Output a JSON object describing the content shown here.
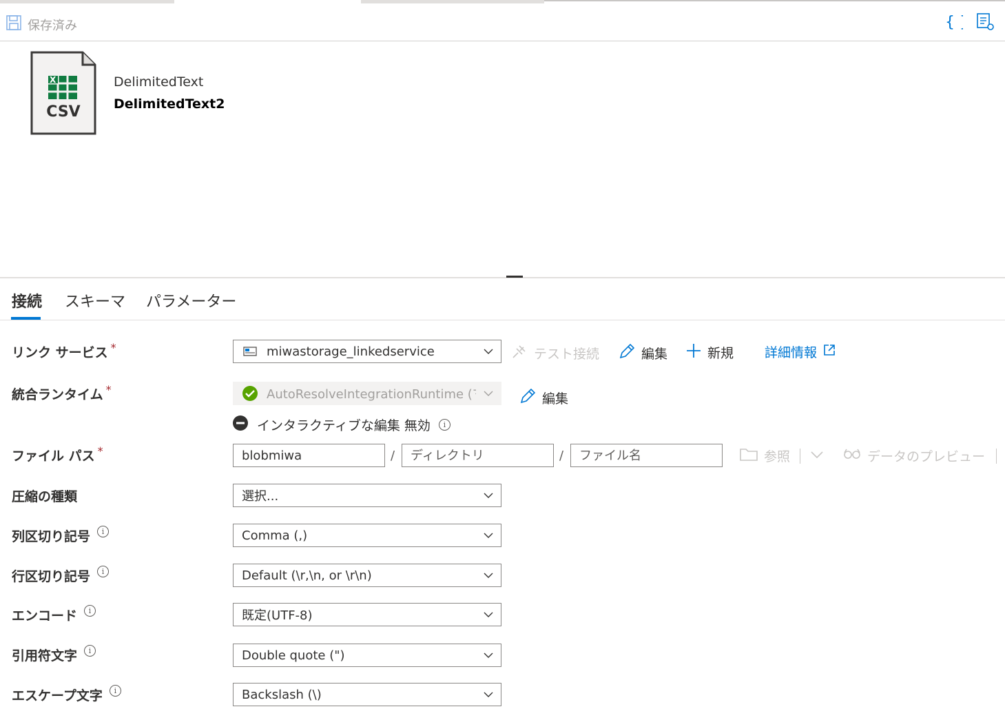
{
  "toolbar": {
    "saved_label": "保存済み",
    "code_icon": "code-braces-icon",
    "properties_icon": "properties-icon"
  },
  "dataset": {
    "icon_label": "CSV",
    "type": "DelimitedText",
    "name": "DelimitedText2"
  },
  "tabs": [
    {
      "label": "接続",
      "active": true
    },
    {
      "label": "スキーマ",
      "active": false
    },
    {
      "label": "パラメーター",
      "active": false
    }
  ],
  "form": {
    "linked_service": {
      "label": "リンク サービス",
      "value": "miwastorage_linkedservice",
      "test_connection": "テスト接続",
      "edit": "編集",
      "new": "新規",
      "details": "詳細情報"
    },
    "integration_runtime": {
      "label": "統合ランタイム",
      "value": "AutoResolveIntegrationRuntime (マ...",
      "edit": "編集",
      "interactive_status": "インタラクティブな編集 無効"
    },
    "file_path": {
      "label": "ファイル パス",
      "container": "blobmiwa",
      "directory_placeholder": "ディレクトリ",
      "filename_placeholder": "ファイル名",
      "separator": "/",
      "browse": "参照",
      "preview": "データのプレビュー"
    },
    "compression": {
      "label": "圧縮の種類",
      "value": "選択..."
    },
    "column_delimiter": {
      "label": "列区切り記号",
      "value": "Comma (,)"
    },
    "row_delimiter": {
      "label": "行区切り記号",
      "value": "Default (\\r,\\n, or \\r\\n)"
    },
    "encoding": {
      "label": "エンコード",
      "value": "既定(UTF-8)"
    },
    "quote_char": {
      "label": "引用符文字",
      "value": "Double quote (\")"
    },
    "escape_char": {
      "label": "エスケープ文字",
      "value": "Backslash (\\)"
    }
  },
  "colors": {
    "accent": "#0078d4",
    "required": "#a4262c",
    "success": "#57a300",
    "excel_green": "#107c41"
  }
}
